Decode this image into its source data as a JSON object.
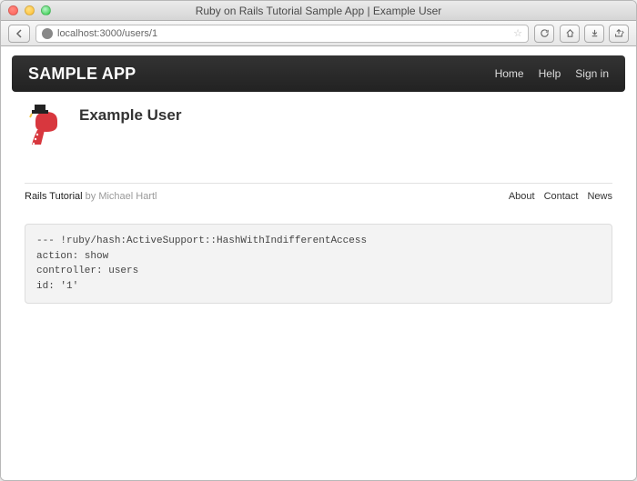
{
  "window": {
    "title": "Ruby on Rails Tutorial Sample App | Example User",
    "url": "localhost:3000/users/1"
  },
  "navbar": {
    "brand": "SAMPLE APP",
    "links": {
      "home": "Home",
      "help": "Help",
      "signin": "Sign in"
    }
  },
  "profile": {
    "name": "Example User"
  },
  "footer": {
    "tutorial": "Rails Tutorial",
    "by": " by ",
    "author": "Michael Hartl",
    "links": {
      "about": "About",
      "contact": "Contact",
      "news": "News"
    }
  },
  "debug": "--- !ruby/hash:ActiveSupport::HashWithIndifferentAccess\naction: show\ncontroller: users\nid: '1'"
}
